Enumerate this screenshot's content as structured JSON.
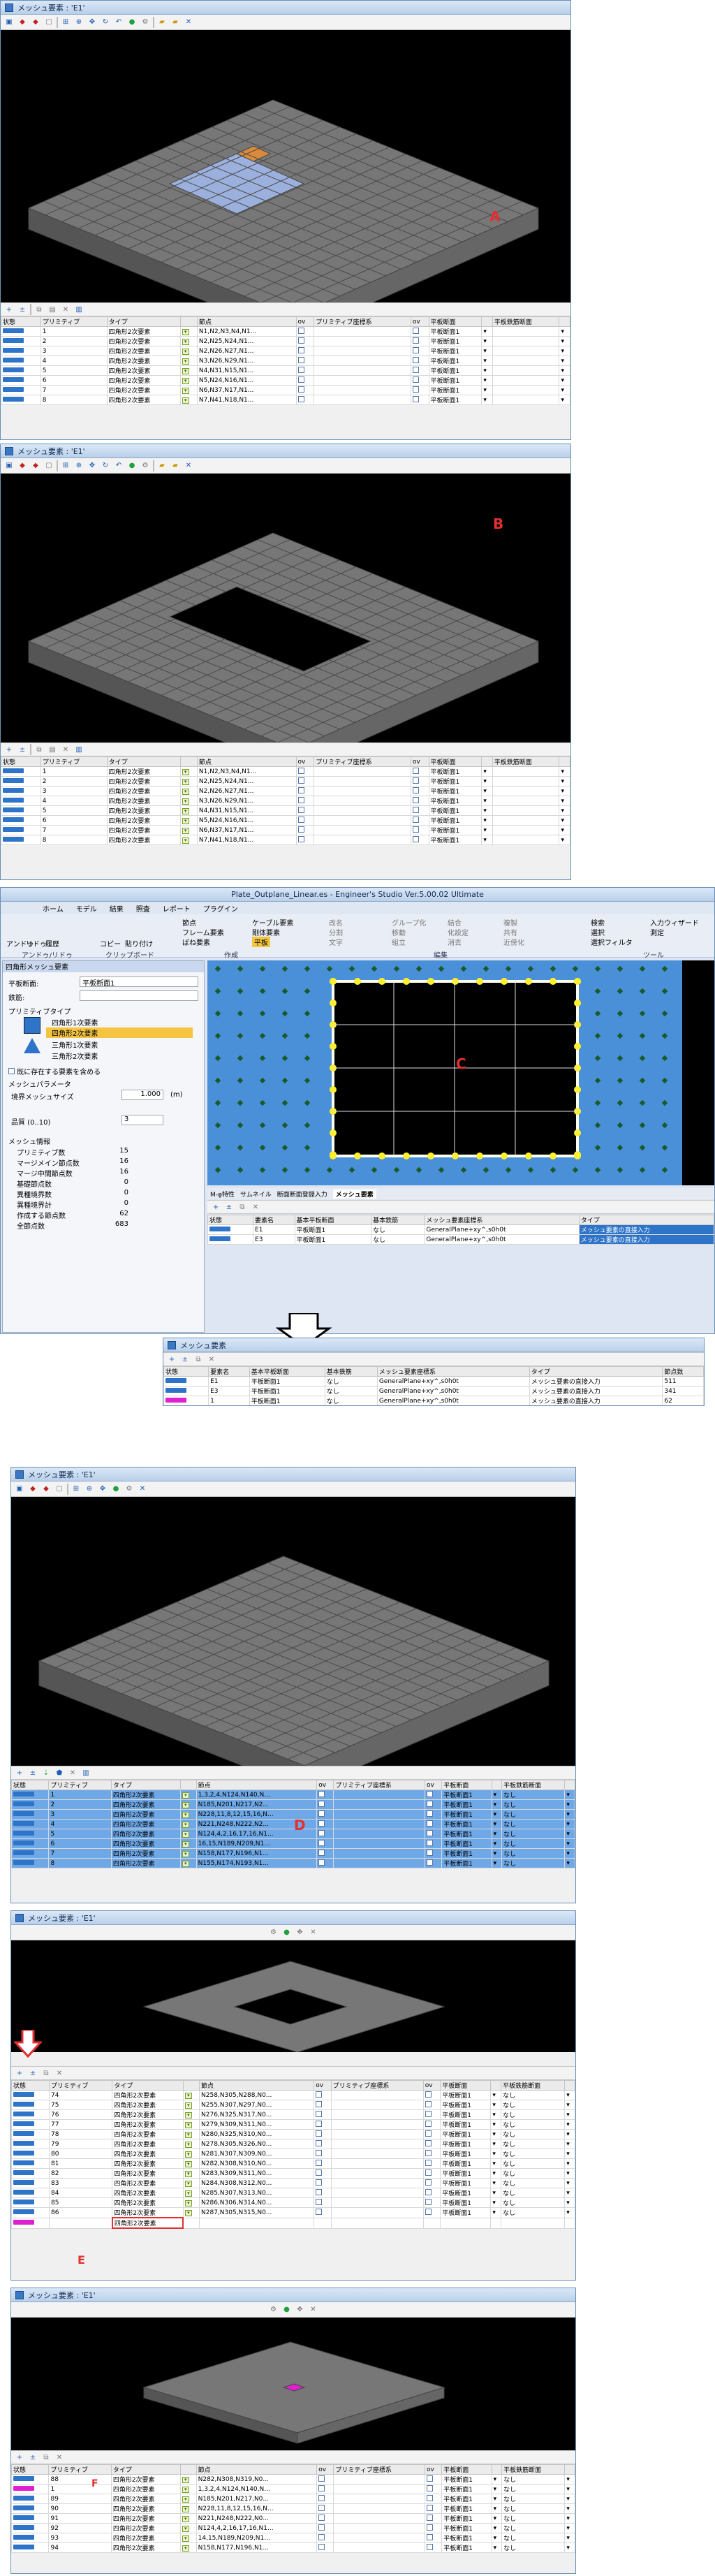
{
  "win_title": "メッシュ要素 : 'E1'",
  "labels": {
    "A": "A",
    "B": "B",
    "C": "C",
    "D": "D",
    "E": "E",
    "F": "F"
  },
  "cols": {
    "state": "状態",
    "prim": "プリミティブ",
    "type": "タイプ",
    "nodes": "節点",
    "ov": "ov",
    "primcoord": "プリミティブ座標系",
    "thick": "平板断面",
    "thick2": "平板鉄筋断面"
  },
  "rowsA": [
    {
      "n": "1",
      "t": "四角形2次要素",
      "p": "N1,N2,N3,N4,N1...",
      "s": "平板断面1"
    },
    {
      "n": "2",
      "t": "四角形2次要素",
      "p": "N2,N25,N24,N1...",
      "s": "平板断面1"
    },
    {
      "n": "3",
      "t": "四角形2次要素",
      "p": "N2,N26,N27,N1...",
      "s": "平板断面1"
    },
    {
      "n": "4",
      "t": "四角形2次要素",
      "p": "N3,N26,N29,N1...",
      "s": "平板断面1"
    },
    {
      "n": "5",
      "t": "四角形2次要素",
      "p": "N4,N31,N15,N1...",
      "s": "平板断面1"
    },
    {
      "n": "6",
      "t": "四角形2次要素",
      "p": "N5,N24,N16,N1...",
      "s": "平板断面1"
    },
    {
      "n": "7",
      "t": "四角形2次要素",
      "p": "N6,N37,N17,N1...",
      "s": "平板断面1"
    },
    {
      "n": "8",
      "t": "四角形2次要素",
      "p": "N7,N41,N18,N1...",
      "s": "平板断面1"
    }
  ],
  "rowsB": [
    {
      "n": "1",
      "t": "四角形2次要素",
      "p": "N1,N2,N3,N4,N1...",
      "s": "平板断面1"
    },
    {
      "n": "2",
      "t": "四角形2次要素",
      "p": "N2,N25,N24,N1...",
      "s": "平板断面1"
    },
    {
      "n": "3",
      "t": "四角形2次要素",
      "p": "N2,N26,N27,N1...",
      "s": "平板断面1"
    },
    {
      "n": "4",
      "t": "四角形2次要素",
      "p": "N3,N26,N29,N1...",
      "s": "平板断面1"
    },
    {
      "n": "5",
      "t": "四角形2次要素",
      "p": "N4,N31,N15,N1...",
      "s": "平板断面1"
    },
    {
      "n": "6",
      "t": "四角形2次要素",
      "p": "N5,N24,N16,N1...",
      "s": "平板断面1"
    },
    {
      "n": "7",
      "t": "四角形2次要素",
      "p": "N6,N37,N17,N1...",
      "s": "平板断面1"
    },
    {
      "n": "8",
      "t": "四角形2次要素",
      "p": "N7,N41,N18,N1...",
      "s": "平板断面1"
    }
  ],
  "app": {
    "title": "Plate_Outplane_Linear.es - Engineer's Studio Ver.5.00.02 Ultimate",
    "menus": [
      "ホーム",
      "モデル",
      "結果",
      "照査",
      "レポート",
      "プラグイン"
    ],
    "ribbon_big": [
      "アンドゥ",
      "リドゥ",
      "履歴",
      "コピー",
      "貼り付け"
    ],
    "ribbon_groups": [
      "アンドゥ/リドゥ",
      "クリップボード",
      "作成",
      "編集",
      "ツール"
    ],
    "create": [
      "節点",
      "フレーム要素",
      "ばね要素",
      "ケーブル要素",
      "剛体要素",
      "平板"
    ],
    "edit": [
      "改名",
      "分割",
      "文字",
      "グループ化",
      "移動",
      "組立",
      "結合",
      "化設定",
      "複製",
      "共有",
      "近傍化",
      "消去",
      "シフト",
      "反転",
      "追加",
      "削除",
      "検索生成"
    ],
    "tools": [
      "検索",
      "入力ウィザード",
      "選択",
      "測定",
      "選択フィルタ"
    ],
    "side_title": "四角形メッシュ要素",
    "thick_label": "平板断面:",
    "thick_value": "平板断面1",
    "rebar_label": "鉄筋:",
    "prim_type_label": "プリミティブタイプ",
    "prims": [
      "四角形1次要素",
      "四角形2次要素",
      "三角形1次要素",
      "三角形2次要素"
    ],
    "chk_existing": "既に存在する要素を含める",
    "mesh_param": "メッシュパラメータ",
    "edge_size_label": "境界メッシュサイズ",
    "edge_size": "1.000",
    "edge_unit": "(m)",
    "quality_label": "品質 (0..10)",
    "quality": "3",
    "info_label": "メッシュ情報",
    "info": [
      [
        "プリミティブ数",
        "15"
      ],
      [
        "マージメイン節点数",
        "16"
      ],
      [
        "マージ中間節点数",
        "16"
      ],
      [
        "基礎節点数",
        "0"
      ],
      [
        "異種境界数",
        "0"
      ],
      [
        "異種境界計",
        "0"
      ],
      [
        "作成する節点数",
        "62"
      ],
      [
        "全節点数",
        "683"
      ]
    ],
    "tabs": [
      "M-φ特性",
      "サムネイル",
      "断面断面登録入力",
      "メッシュ要素"
    ],
    "cols": [
      "状態",
      "要素名",
      "基本平板断面",
      "基本鉄筋",
      "メッシュ要素座標系",
      "タイプ"
    ],
    "rows": [
      {
        "name": "E1",
        "sec": "平板断面1",
        "rebar": "なし",
        "coord": "GeneralPlane+xy^,s0h0t",
        "type": "メッシュ要素の直接入力"
      },
      {
        "name": "E3",
        "sec": "平板断面1",
        "rebar": "なし",
        "coord": "GeneralPlane+xy^,s0h0t",
        "type": "メッシュ要素の直接入力"
      }
    ]
  },
  "mini": {
    "title": "メッシュ要素",
    "cols": [
      "状態",
      "要素名",
      "基本平板断面",
      "基本鉄筋",
      "メッシュ要素座標系",
      "タイプ",
      "節点数"
    ],
    "rows": [
      {
        "name": "E1",
        "sec": "平板断面1",
        "rebar": "なし",
        "coord": "GeneralPlane+xy^,s0h0t",
        "type": "メッシュ要素の直接入力",
        "n": "511"
      },
      {
        "name": "E3",
        "sec": "平板断面1",
        "rebar": "なし",
        "coord": "GeneralPlane+xy^,s0h0t",
        "type": "メッシュ要素の直接入力",
        "n": "341"
      },
      {
        "name": "1",
        "sec": "平板断面1",
        "rebar": "なし",
        "coord": "GeneralPlane+xy^,s0h0t",
        "type": "メッシュ要素の直接入力",
        "n": "62"
      }
    ]
  },
  "rowsD": [
    {
      "n": "1",
      "t": "四角形2次要素",
      "p": "1,3,2,4,N124,N140,N...",
      "s": "平板断面1",
      "s2": "なし"
    },
    {
      "n": "2",
      "t": "四角形2次要素",
      "p": "N185,N201,N217,N2...",
      "s": "平板断面1",
      "s2": "なし"
    },
    {
      "n": "3",
      "t": "四角形2次要素",
      "p": "N228,11,8,12,15,16,N...",
      "s": "平板断面1",
      "s2": "なし"
    },
    {
      "n": "4",
      "t": "四角形2次要素",
      "p": "N221,N248,N222,N2...",
      "s": "平板断面1",
      "s2": "なし"
    },
    {
      "n": "5",
      "t": "四角形2次要素",
      "p": "N124,4,2,16,17,16,N1...",
      "s": "平板断面1",
      "s2": "なし"
    },
    {
      "n": "6",
      "t": "四角形2次要素",
      "p": "16,15,N189,N209,N1...",
      "s": "平板断面1",
      "s2": "なし"
    },
    {
      "n": "7",
      "t": "四角形2次要素",
      "p": "N158,N177,N196,N1...",
      "s": "平板断面1",
      "s2": "なし"
    },
    {
      "n": "8",
      "t": "四角形2次要素",
      "p": "N155,N174,N193,N1...",
      "s": "平板断面1",
      "s2": "なし"
    }
  ],
  "rowsE": [
    {
      "n": "74",
      "t": "四角形2次要素",
      "p": "N258,N305,N288,N0...",
      "s": "平板断面1",
      "s2": "なし"
    },
    {
      "n": "75",
      "t": "四角形2次要素",
      "p": "N255,N307,N297,N0...",
      "s": "平板断面1",
      "s2": "なし"
    },
    {
      "n": "76",
      "t": "四角形2次要素",
      "p": "N276,N325,N317,N0...",
      "s": "平板断面1",
      "s2": "なし"
    },
    {
      "n": "77",
      "t": "四角形2次要素",
      "p": "N279,N309,N311,N0...",
      "s": "平板断面1",
      "s2": "なし"
    },
    {
      "n": "78",
      "t": "四角形2次要素",
      "p": "N280,N325,N310,N0...",
      "s": "平板断面1",
      "s2": "なし"
    },
    {
      "n": "79",
      "t": "四角形2次要素",
      "p": "N278,N305,N326,N0...",
      "s": "平板断面1",
      "s2": "なし"
    },
    {
      "n": "80",
      "t": "四角形2次要素",
      "p": "N281,N307,N309,N0...",
      "s": "平板断面1",
      "s2": "なし"
    },
    {
      "n": "81",
      "t": "四角形2次要素",
      "p": "N282,N308,N310,N0...",
      "s": "平板断面1",
      "s2": "なし"
    },
    {
      "n": "82",
      "t": "四角形2次要素",
      "p": "N283,N309,N311,N0...",
      "s": "平板断面1",
      "s2": "なし"
    },
    {
      "n": "83",
      "t": "四角形2次要素",
      "p": "N284,N308,N312,N0...",
      "s": "平板断面1",
      "s2": "なし"
    },
    {
      "n": "84",
      "t": "四角形2次要素",
      "p": "N285,N307,N313,N0...",
      "s": "平板断面1",
      "s2": "なし"
    },
    {
      "n": "85",
      "t": "四角形2次要素",
      "p": "N286,N306,N314,N0...",
      "s": "平板断面1",
      "s2": "なし"
    },
    {
      "n": "86",
      "t": "四角形2次要素",
      "p": "N287,N305,N315,N0...",
      "s": "平板断面1",
      "s2": "なし"
    }
  ],
  "newrow_type": "四角形2次要素",
  "rowsF": [
    {
      "n": "88",
      "t": "四角形2次要素",
      "p": "N282,N308,N319,N0...",
      "s": "平板断面1",
      "s2": "なし"
    },
    {
      "n": "1",
      "t": "四角形2次要素",
      "p": "1,3,2,4,N124,N140,N...",
      "s": "平板断面1",
      "s2": "なし"
    },
    {
      "n": "89",
      "t": "四角形2次要素",
      "p": "N185,N201,N217,N0...",
      "s": "平板断面1",
      "s2": "なし"
    },
    {
      "n": "90",
      "t": "四角形2次要素",
      "p": "N228,11,8,12,15,16,N...",
      "s": "平板断面1",
      "s2": "なし"
    },
    {
      "n": "91",
      "t": "四角形2次要素",
      "p": "N221,N248,N222,N0...",
      "s": "平板断面1",
      "s2": "なし"
    },
    {
      "n": "92",
      "t": "四角形2次要素",
      "p": "N124,4,2,16,17,16,N1...",
      "s": "平板断面1",
      "s2": "なし"
    },
    {
      "n": "93",
      "t": "四角形2次要素",
      "p": "14,15,N189,N209,N1...",
      "s": "平板断面1",
      "s2": "なし"
    },
    {
      "n": "94",
      "t": "四角形2次要素",
      "p": "N158,N177,N196,N1...",
      "s": "平板断面1",
      "s2": "なし"
    }
  ]
}
